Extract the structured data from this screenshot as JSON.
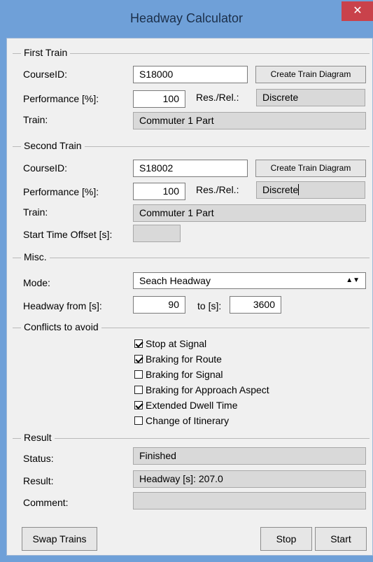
{
  "window": {
    "title": "Headway Calculator",
    "close_glyph": "✕"
  },
  "first_train": {
    "group": "First Train",
    "course_label": "CourseID:",
    "course_value": "S18000",
    "diagram_button": "Create Train Diagram",
    "performance_label": "Performance [%]:",
    "performance_value": "100",
    "resrel_label": "Res./Rel.:",
    "resrel_value": "Discrete",
    "train_label": "Train:",
    "train_value": "Commuter 1 Part"
  },
  "second_train": {
    "group": "Second Train",
    "course_label": "CourseID:",
    "course_value": "S18002",
    "diagram_button": "Create Train Diagram",
    "performance_label": "Performance [%]:",
    "performance_value": "100",
    "resrel_label": "Res./Rel.:",
    "resrel_value": "Discrete",
    "train_label": "Train:",
    "train_value": "Commuter 1 Part",
    "offset_label": "Start Time Offset [s]:",
    "offset_value": ""
  },
  "misc": {
    "group": "Misc.",
    "mode_label": "Mode:",
    "mode_value": "Seach Headway",
    "headway_from_label": "Headway from [s]:",
    "headway_from_value": "90",
    "to_label": "to [s]:",
    "to_value": "3600"
  },
  "conflicts": {
    "group": "Conflicts to avoid",
    "items": [
      {
        "label": "Stop at Signal",
        "checked": true
      },
      {
        "label": "Braking for Route",
        "checked": true
      },
      {
        "label": "Braking for Signal",
        "checked": false
      },
      {
        "label": "Braking for Approach Aspect",
        "checked": false
      },
      {
        "label": "Extended Dwell Time",
        "checked": true
      },
      {
        "label": "Change of Itinerary",
        "checked": false
      }
    ]
  },
  "result": {
    "group": "Result",
    "status_label": "Status:",
    "status_value": "Finished",
    "result_label": "Result:",
    "result_value": "Headway [s]: 207.0",
    "comment_label": "Comment:",
    "comment_value": ""
  },
  "buttons": {
    "swap": "Swap Trains",
    "stop": "Stop",
    "start": "Start"
  },
  "colors": {
    "titlebar": "#6fa0d8",
    "close": "#c9424b",
    "dialog": "#f0f0f0",
    "readonly": "#d9d9d9"
  }
}
